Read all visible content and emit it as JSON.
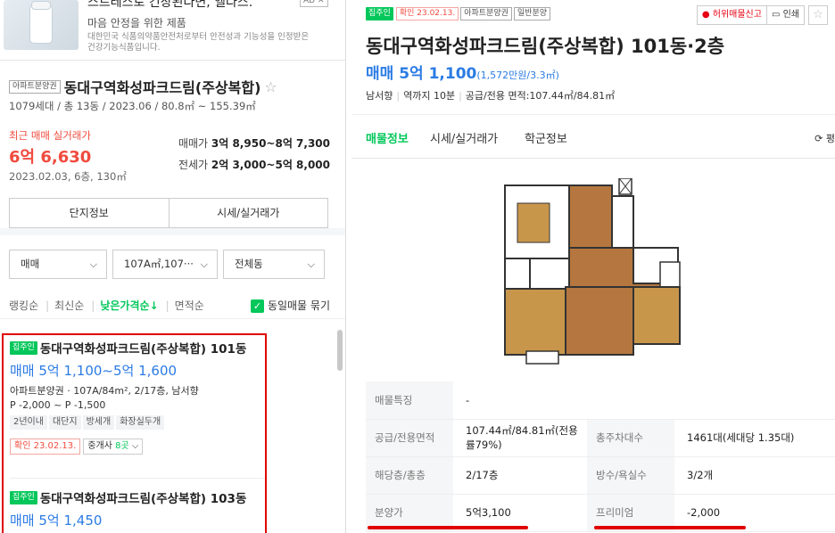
{
  "ad": {
    "title": "스트레스로 긴장된다면, 엘다스.",
    "subtitle": "마음 안정을 위한 제품",
    "desc": "대한민국 식품의약품안전처로부터 안전성과 기능성을 인정받은 건강기능식품입니다.",
    "badge": "AD ✕"
  },
  "complex": {
    "tag": "아파트분양권",
    "name": "동대구역화성파크드림(주상복합)",
    "star": "☆",
    "info": "1079세대 / 총 13동 / 2023.06 / 80.8㎡ ~ 155.39㎡",
    "recent_label": "최근 매매 실거래가",
    "recent_price": "6억 6,630",
    "recent_date": "2023.02.03, 6층, 130㎡",
    "sale_label": "매매가",
    "sale_range": "3억 8,950~8억 7,300",
    "lease_label": "전세가",
    "lease_range": "2억 3,000~5억 8,000",
    "btn_info": "단지정보",
    "btn_price": "시세/실거래가"
  },
  "filters": {
    "trade": "매매",
    "area": "107A㎡,107···",
    "dong": "전체동",
    "chev": "⌵"
  },
  "sort": {
    "items": [
      "랭킹순",
      "최신순",
      "낮은가격순↓",
      "면적순"
    ],
    "group_label": "동일매물 묶기",
    "check": "✓"
  },
  "listings": [
    {
      "tag": "집주인",
      "title": "동대구역화성파크드림(주상복합) 101동",
      "price": "매매 5억 1,100~5억 1,600",
      "spec": "아파트분양권 · 107A/84m², 2/17층, 남서향",
      "premium": "P -2,000 ~ P -1,500",
      "chips": [
        "2년이내",
        "대단지",
        "방세개",
        "화장실두개"
      ],
      "confirm": "확인 23.02.13.",
      "agent_prefix": "중개사 ",
      "agent_count": "8곳",
      "agent_chev": " ⌵"
    },
    {
      "tag": "집주인",
      "title": "동대구역화성파크드림(주상복합) 103동",
      "price": "매매 5억 1,450"
    }
  ],
  "detail": {
    "tag_owner": "집주인",
    "tag_confirm": "확인 23.02.13.",
    "tag_type": "아파트분양권",
    "tag_sale": "일반분양",
    "report": "허위매물신고",
    "report_icon": "●",
    "print": "인쇄",
    "print_icon": "▭",
    "star": "☆",
    "title": "동대구역화성파크드림(주상복합) 101동·2층",
    "price": "매매 5억 1,100",
    "price_per": "(1,572만원/3.3㎡)",
    "info": [
      "남서향",
      "역까지 10분",
      "공급/전용 면적:107.44㎡/84.81㎡"
    ],
    "tabs": [
      "매물정보",
      "시세/실거래가",
      "학군정보"
    ],
    "refresh": "⟳ 평",
    "table": [
      [
        {
          "label": "매물특징",
          "value": "-"
        }
      ],
      [
        {
          "label": "공급/전용면적",
          "value": "107.44㎡/84.81㎡(전용률79%)"
        },
        {
          "label": "총주차대수",
          "value": "1461대(세대당 1.35대)"
        }
      ],
      [
        {
          "label": "해당층/총층",
          "value": "2/17층"
        },
        {
          "label": "방수/욕실수",
          "value": "3/2개"
        }
      ],
      [
        {
          "label": "분양가",
          "value": "5억3,100"
        },
        {
          "label": "프리미엄",
          "value": "-2,000"
        }
      ]
    ]
  },
  "colors": {
    "accent_green": "#03c75a",
    "price_blue": "#2b7be4",
    "alert_red": "#f04b3e",
    "highlight_red": "#e00000"
  }
}
